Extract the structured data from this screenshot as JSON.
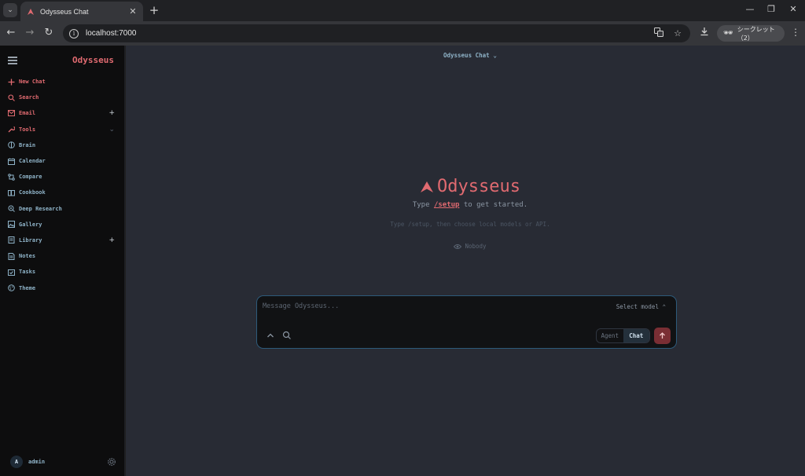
{
  "browser": {
    "tab_title": "Odysseus Chat",
    "tab_close": "✕",
    "new_tab": "+",
    "url": "localhost:7000",
    "incognito_label": "シークレット（2）",
    "window_controls": {
      "minimize": "—",
      "maximize": "❐",
      "close": "✕"
    },
    "nav": {
      "back": "←",
      "forward": "→",
      "reload": "↻"
    }
  },
  "sidebar": {
    "brand": "Odysseus",
    "items": [
      {
        "label": "New Chat",
        "icon": "plus-icon",
        "accent": true
      },
      {
        "label": "Search",
        "icon": "search-icon",
        "accent": true
      },
      {
        "label": "Email",
        "icon": "mail-icon",
        "accent": true,
        "right": "+"
      },
      {
        "label": "Tools",
        "icon": "wrench-icon",
        "accent": true,
        "right": "⌄"
      },
      {
        "label": "Brain",
        "icon": "brain-icon"
      },
      {
        "label": "Calendar",
        "icon": "calendar-icon"
      },
      {
        "label": "Compare",
        "icon": "compare-icon"
      },
      {
        "label": "Cookbook",
        "icon": "book-icon"
      },
      {
        "label": "Deep Research",
        "icon": "research-icon"
      },
      {
        "label": "Gallery",
        "icon": "image-icon"
      },
      {
        "label": "Library",
        "icon": "library-icon",
        "right": "+"
      },
      {
        "label": "Notes",
        "icon": "notes-icon"
      },
      {
        "label": "Tasks",
        "icon": "tasks-icon"
      },
      {
        "label": "Theme",
        "icon": "palette-icon"
      }
    ],
    "user": {
      "avatar": "A",
      "name": "admin"
    }
  },
  "main": {
    "model_title": "Odysseus Chat",
    "hero": {
      "title": "Odysseus",
      "sub_before": "Type ",
      "sub_cmd": "/setup",
      "sub_after": " to get started.",
      "hint": "Type /setup, then choose local models or API.",
      "persona": "Nobody"
    },
    "composer": {
      "placeholder": "Message Odysseus...",
      "select_model": "Select model ⌃",
      "modes": [
        "Agent",
        "Chat"
      ],
      "active_mode": "Chat"
    }
  },
  "colors": {
    "accent": "#e06a70",
    "text": "#8fb3c8",
    "sidebar_bg": "#0d0d0e",
    "main_bg": "#282b34"
  }
}
